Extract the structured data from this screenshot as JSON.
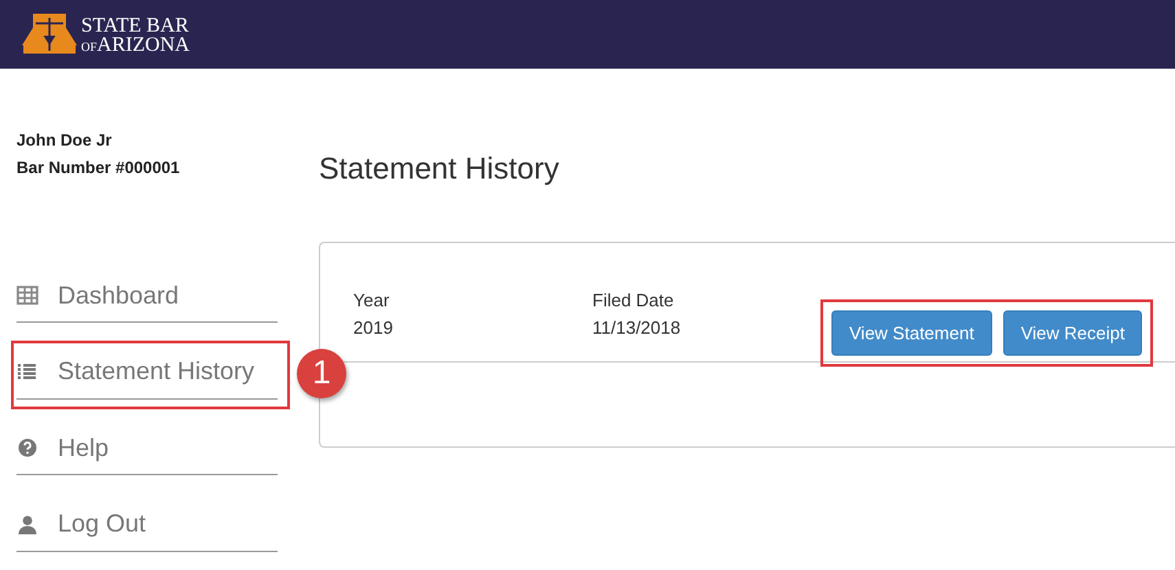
{
  "header": {
    "logo_line_1": "STATE BAR",
    "logo_line_2_small": "OF",
    "logo_line_2": "ARIZONA"
  },
  "user": {
    "name": "John Doe Jr",
    "bar_number": "Bar Number #000001"
  },
  "sidebar": {
    "items": [
      {
        "label": "Dashboard",
        "highlighted": false
      },
      {
        "label": "Statement History",
        "highlighted": true,
        "callout": "1"
      },
      {
        "label": "Help",
        "highlighted": false
      },
      {
        "label": "Log Out",
        "highlighted": false
      }
    ]
  },
  "page_title": "Statement History",
  "statements": {
    "columns": [
      "Year",
      "Filed Date"
    ],
    "rows": [
      {
        "cells": [
          "2019",
          "11/13/2018"
        ],
        "actions": [
          "View Statement",
          "View Receipt"
        ],
        "actions_highlighted": true
      }
    ]
  }
}
